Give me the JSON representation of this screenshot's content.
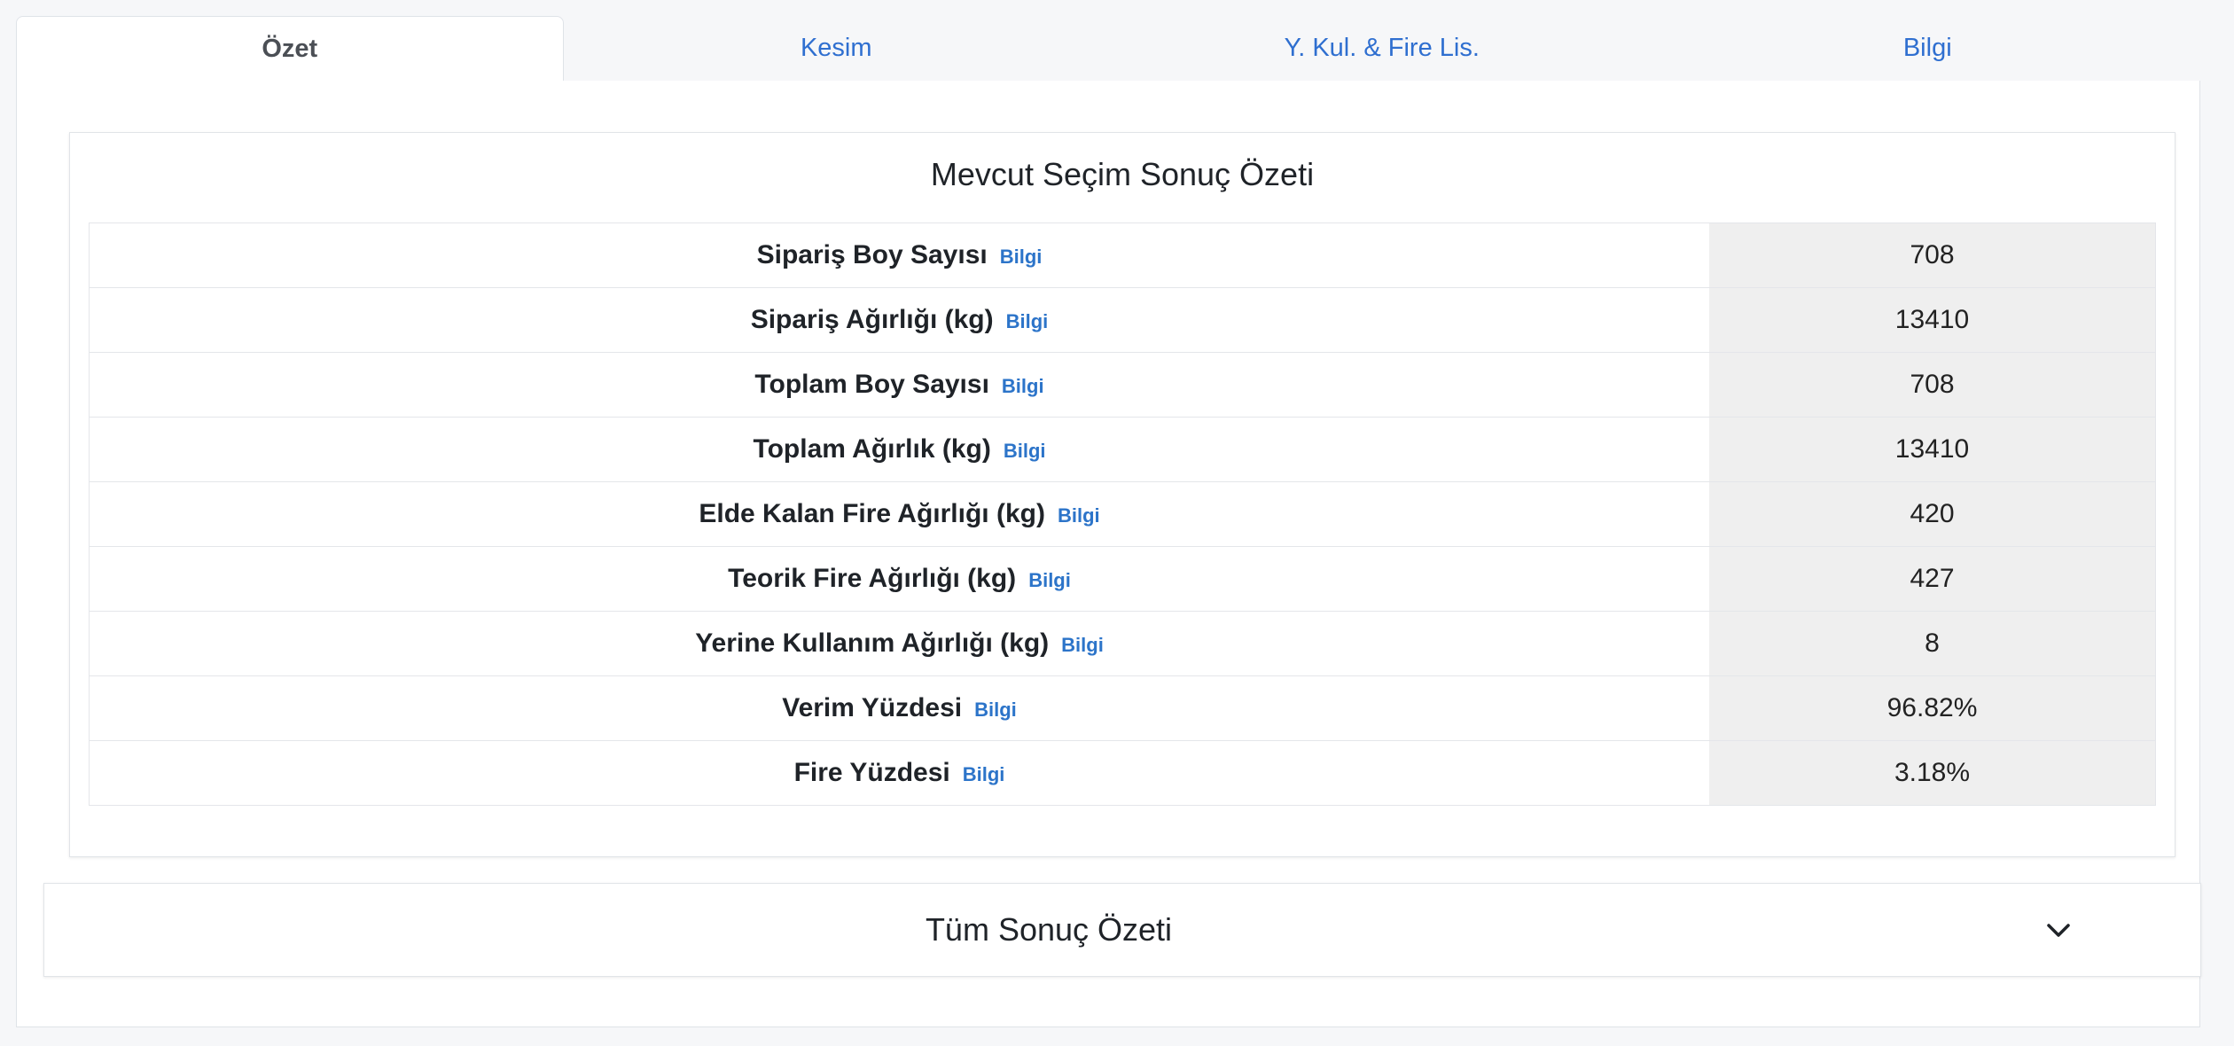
{
  "tabs": [
    {
      "label": "Özet",
      "active": true
    },
    {
      "label": "Kesim",
      "active": false
    },
    {
      "label": "Y. Kul. & Fire Lis.",
      "active": false
    },
    {
      "label": "Bilgi",
      "active": false
    }
  ],
  "summary": {
    "title": "Mevcut Seçim Sonuç Özeti",
    "info_label": "Bilgi",
    "rows": [
      {
        "label": "Sipariş Boy Sayısı",
        "value": "708"
      },
      {
        "label": "Sipariş Ağırlığı (kg)",
        "value": "13410"
      },
      {
        "label": "Toplam Boy Sayısı",
        "value": "708"
      },
      {
        "label": "Toplam Ağırlık (kg)",
        "value": "13410"
      },
      {
        "label": "Elde Kalan Fire Ağırlığı (kg)",
        "value": "420"
      },
      {
        "label": "Teorik Fire Ağırlığı (kg)",
        "value": "427"
      },
      {
        "label": "Yerine Kullanım Ağırlığı (kg)",
        "value": "8"
      },
      {
        "label": "Verim Yüzdesi",
        "value": "96.82%"
      },
      {
        "label": "Fire Yüzdesi",
        "value": "3.18%"
      }
    ]
  },
  "accordion": {
    "title": "Tüm Sonuç Özeti",
    "icon": "chevron-down-icon",
    "expanded": false
  },
  "colors": {
    "link": "#2f6fd0",
    "info_link": "#2c74c9",
    "value_cell_bg": "#efefef",
    "page_bg": "#f6f7f9"
  }
}
